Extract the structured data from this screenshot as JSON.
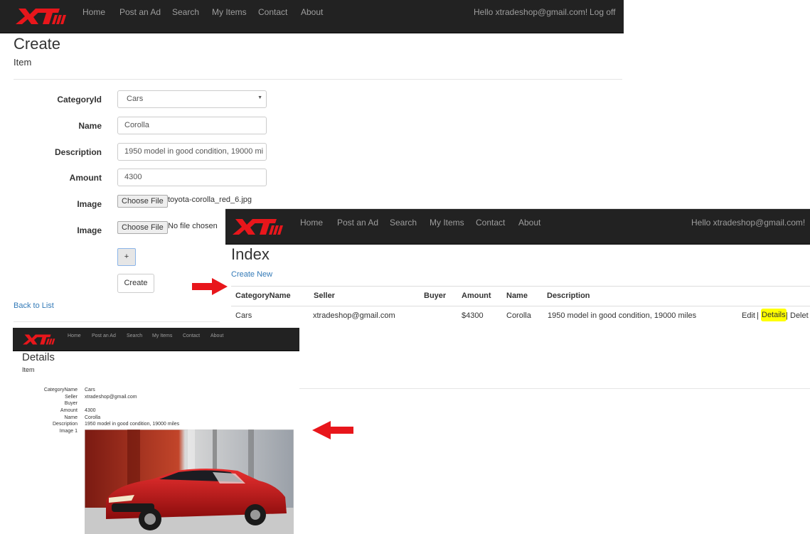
{
  "nav": {
    "items": [
      "Home",
      "Post an Ad",
      "Search",
      "My Items",
      "Contact",
      "About"
    ],
    "hello": "Hello xtradeshop@gmail.com!",
    "logoff": "Log off"
  },
  "create": {
    "title": "Create",
    "subtitle": "Item",
    "category_label": "CategoryId",
    "category_value": "Cars",
    "name_label": "Name",
    "name_value": "Corolla",
    "description_label": "Description",
    "description_value": "1950 model in good condition, 19000 mi",
    "amount_label": "Amount",
    "amount_value": "4300",
    "image_label": "Image",
    "choose_file": "Choose File",
    "file1": "toyota-corolla_red_6.jpg",
    "file2": "No file chosen",
    "plus": "+",
    "create_button": "Create",
    "back": "Back to List"
  },
  "index": {
    "title": "Index",
    "create_new": "Create New",
    "headers": [
      "CategoryName",
      "Seller",
      "Buyer",
      "Amount",
      "Name",
      "Description"
    ],
    "row": {
      "category": "Cars",
      "seller": "xtradeshop@gmail.com",
      "buyer": "",
      "amount": "$4300",
      "name": "Corolla",
      "description": "1950 model in good condition, 19000 miles",
      "edit": "Edit",
      "sep": "|",
      "details": "Details",
      "delete": "Delet"
    }
  },
  "details": {
    "title": "Details",
    "subtitle": "Item",
    "labels": [
      "CategoryName",
      "Seller",
      "Buyer",
      "Amount",
      "Name",
      "Description",
      "Image 1"
    ],
    "values": [
      "Cars",
      "xtradeshop@gmail.com",
      "",
      "4300",
      "Corolla",
      "1950 model in good condition, 19000 miles",
      ""
    ]
  },
  "colors": {
    "navbar": "#222222",
    "accent_red": "#e8161b",
    "link": "#337ab7",
    "highlight": "#ffff00"
  }
}
